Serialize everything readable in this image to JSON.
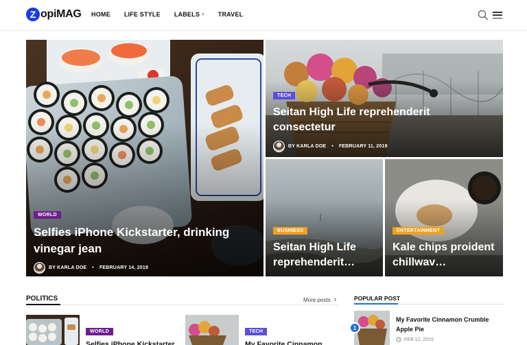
{
  "header": {
    "logo_mark": "Z",
    "logo_text": "opiMAG",
    "nav": [
      {
        "label": "HOME"
      },
      {
        "label": "LIFE STYLE"
      },
      {
        "label": "LABELS"
      },
      {
        "label": "TRAVEL"
      }
    ],
    "labels_caret": "▾"
  },
  "featured": [
    {
      "category": "WORLD",
      "title": "Selfies iPhone Kickstarter, drinking vinegar jean",
      "author": "BY KARLA DOE",
      "date": "FEBRUARY 14, 2019",
      "color": "#6d1e8c"
    },
    {
      "category": "TECH",
      "title": "Seitan High Life reprehenderit consectetur",
      "author": "BY KARLA DOE",
      "date": "FEBRUARY 11, 2019",
      "color": "#5b4fd6"
    },
    {
      "category": "BUSINESS",
      "title": "Seitan High Life reprehenderit…",
      "color": "#f0a020"
    },
    {
      "category": "ENTERTAINMENT",
      "title": "Kale chips proident chillwav…",
      "color": "#f0a020"
    }
  ],
  "politics": {
    "heading": "POLITICS",
    "more": "More posts",
    "more_arrow": "›",
    "cards": [
      {
        "category": "WORLD",
        "title": "Selfies iPhone Kickstarter,",
        "color": "#6d1e8c"
      },
      {
        "category": "TECH",
        "title": "My Favorite Cinnamon",
        "color": "#5b4fd6"
      }
    ]
  },
  "popular": {
    "heading": "POPULAR POST",
    "items": [
      {
        "rank": "1",
        "title": "My Favorite Cinnamon Crumble Apple Pie",
        "date": "FEB 12, 2019"
      }
    ]
  },
  "colors": {
    "accent": "#1d3cd8",
    "rank_badge": "#1e6fd9"
  }
}
